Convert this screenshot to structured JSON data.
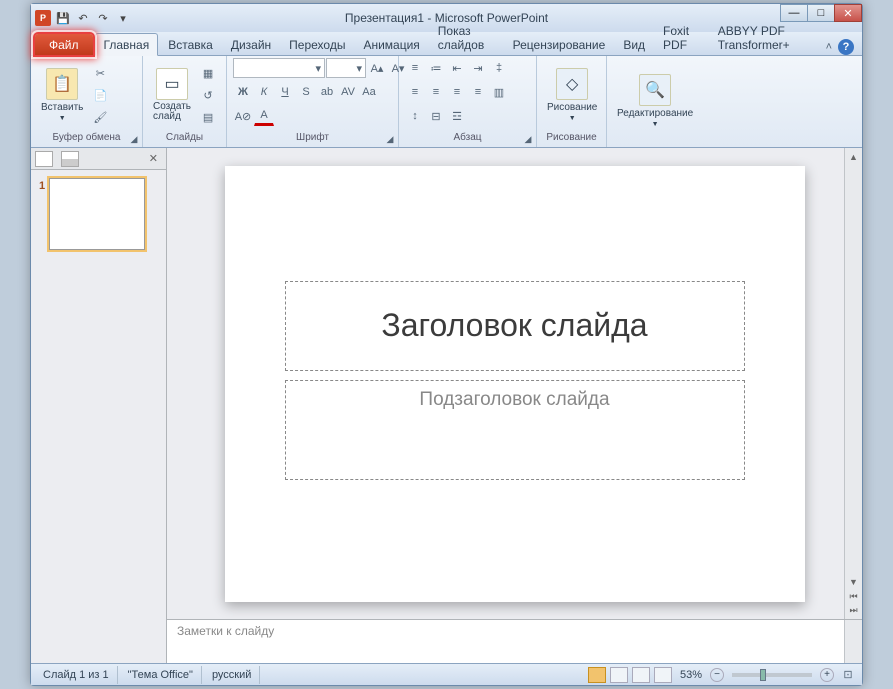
{
  "title": "Презентация1 - Microsoft PowerPoint",
  "qat": {
    "save": "💾",
    "undo": "↶",
    "redo": "↷"
  },
  "win": {
    "min": "—",
    "max": "□",
    "close": "✕",
    "rib_min": "˄"
  },
  "tabs": {
    "file": "Файл",
    "items": [
      "Главная",
      "Вставка",
      "Дизайн",
      "Переходы",
      "Анимация",
      "Показ слайдов",
      "Рецензирование",
      "Вид",
      "Foxit PDF",
      "ABBYY PDF Transformer+"
    ]
  },
  "ribbon": {
    "clipboard": {
      "label": "Буфер обмена",
      "paste": "Вставить"
    },
    "slides": {
      "label": "Слайды",
      "new": "Создать\nслайд"
    },
    "font": {
      "label": "Шрифт"
    },
    "paragraph": {
      "label": "Абзац"
    },
    "drawing": {
      "label": "Рисование",
      "btn": "Рисование"
    },
    "editing": {
      "label": "",
      "btn": "Редактирование"
    }
  },
  "side": {
    "close": "✕",
    "thumb_num": "1"
  },
  "slide": {
    "title_ph": "Заголовок слайда",
    "subtitle_ph": "Подзаголовок слайда"
  },
  "notes": {
    "placeholder": "Заметки к слайду"
  },
  "status": {
    "slide_info": "Слайд 1 из 1",
    "theme": "\"Тема Office\"",
    "lang": "русский",
    "zoom": "53%",
    "fit": "⊡"
  }
}
